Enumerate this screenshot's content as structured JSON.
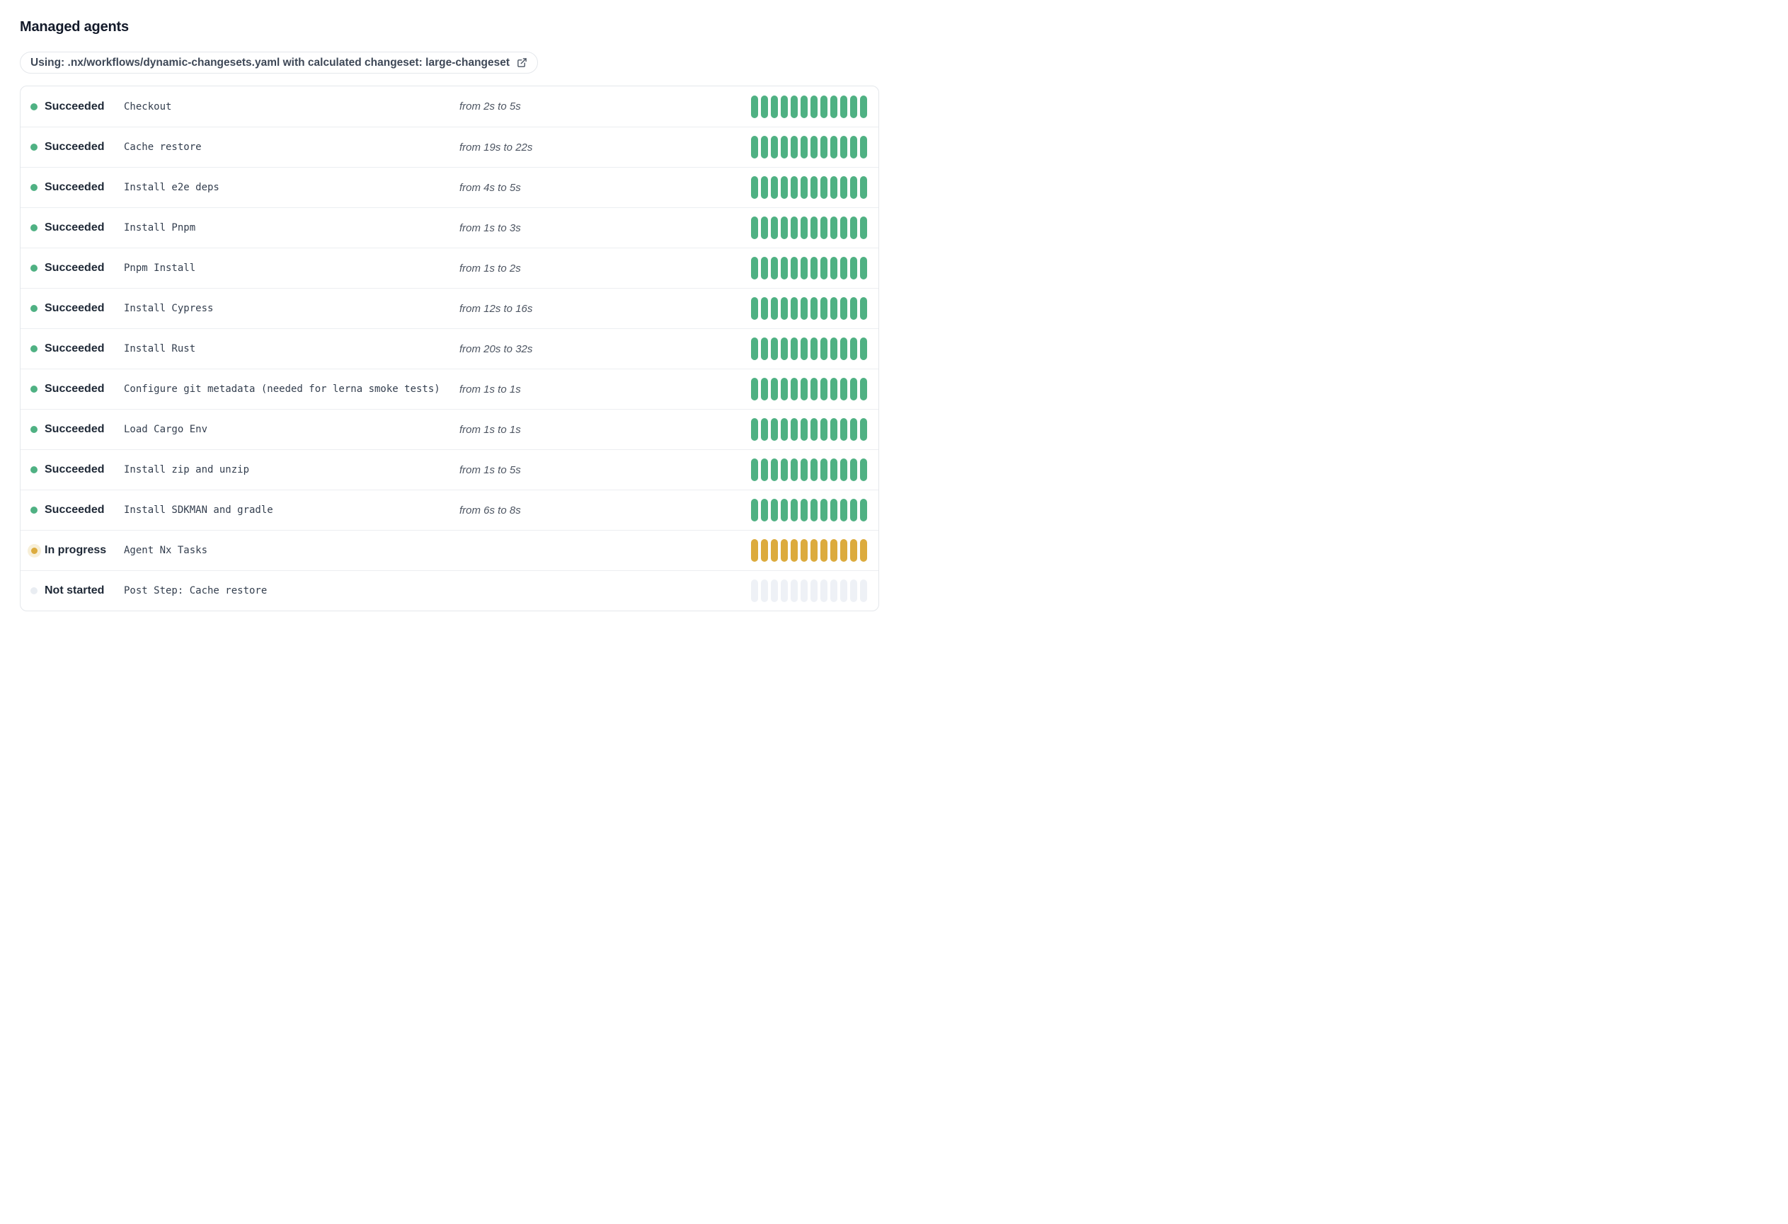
{
  "page": {
    "title": "Managed agents"
  },
  "workflow_banner": {
    "text": "Using: .nx/workflows/dynamic-changesets.yaml with calculated changeset: large-changeset",
    "icon": "external-link-icon"
  },
  "agents_table": {
    "bar_segment_count": 12,
    "statuses": {
      "succeeded": {
        "label": "Succeeded",
        "color": "#4fb183"
      },
      "in_progress": {
        "label": "In progress",
        "color": "#dcab3d"
      },
      "not_started": {
        "label": "Not started",
        "color": "#eef1f6"
      }
    },
    "rows": [
      {
        "status": "succeeded",
        "name": "Checkout",
        "duration": "from 2s to 5s"
      },
      {
        "status": "succeeded",
        "name": "Cache restore",
        "duration": "from 19s to 22s"
      },
      {
        "status": "succeeded",
        "name": "Install e2e deps",
        "duration": "from 4s to 5s"
      },
      {
        "status": "succeeded",
        "name": "Install Pnpm",
        "duration": "from 1s to 3s"
      },
      {
        "status": "succeeded",
        "name": "Pnpm Install",
        "duration": "from 1s to 2s"
      },
      {
        "status": "succeeded",
        "name": "Install Cypress",
        "duration": "from 12s to 16s"
      },
      {
        "status": "succeeded",
        "name": "Install Rust",
        "duration": "from 20s to 32s"
      },
      {
        "status": "succeeded",
        "name": "Configure git metadata (needed for lerna smoke tests)",
        "duration": "from 1s to 1s"
      },
      {
        "status": "succeeded",
        "name": "Load Cargo Env",
        "duration": "from 1s to 1s"
      },
      {
        "status": "succeeded",
        "name": "Install zip and unzip",
        "duration": "from 1s to 5s"
      },
      {
        "status": "succeeded",
        "name": "Install SDKMAN and gradle",
        "duration": "from 6s to 8s"
      },
      {
        "status": "in_progress",
        "name": "Agent Nx Tasks",
        "duration": ""
      },
      {
        "status": "not_started",
        "name": "Post Step: Cache restore",
        "duration": ""
      }
    ]
  }
}
